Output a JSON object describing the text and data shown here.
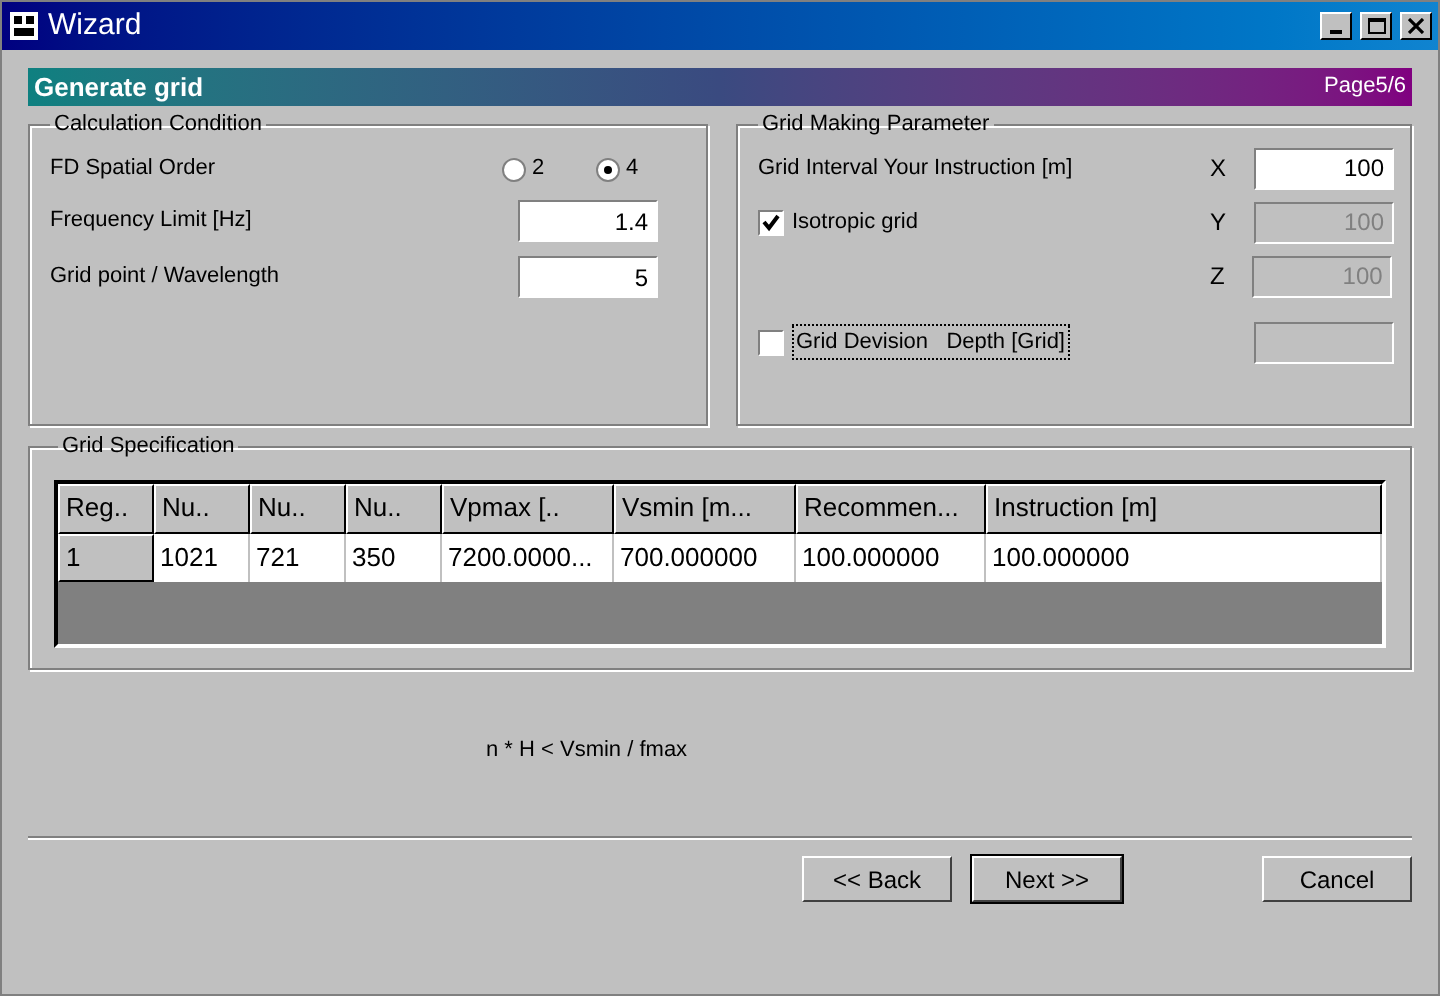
{
  "window": {
    "title": "Wizard"
  },
  "header": {
    "title": "Generate grid",
    "page": "Page5/6"
  },
  "calculation": {
    "title": "Calculation Condition",
    "order_label": "FD Spatial Order",
    "order_options": [
      {
        "label": "2",
        "selected": false
      },
      {
        "label": "4",
        "selected": true
      }
    ],
    "fields": [
      {
        "label": "Frequency Limit [Hz]",
        "value": "1.4"
      },
      {
        "label": "Grid point / Wavelength",
        "value": "5"
      }
    ]
  },
  "grid_making": {
    "title": "Grid Making Parameter",
    "interval_label": "Grid Interval Your Instruction [m]",
    "axes": [
      {
        "label": "X",
        "value": "100",
        "disabled": false
      },
      {
        "label": "Y",
        "value": "100",
        "disabled": true
      },
      {
        "label": "Z",
        "value": "100",
        "disabled": true
      }
    ],
    "isotropic": {
      "label": "Isotropic grid",
      "checked": true
    },
    "division": {
      "label": "Grid Devision   Depth [Grid]",
      "checked": false,
      "field_disabled": true
    }
  },
  "grid_specification": {
    "title": "Grid Specification",
    "columns": [
      "Reg..",
      "Nu..",
      "Nu..",
      "Nu..",
      "Vpmax [..",
      "Vsmin [m...",
      "Recommen...",
      "Instruction [m]"
    ],
    "rows": [
      [
        "1",
        "1021",
        "721",
        "350",
        "7200.0000...",
        "700.000000",
        "100.000000",
        "100.000000"
      ]
    ]
  },
  "formula": "n * H < Vsmin / fmax",
  "buttons": [
    {
      "label": "<< Back",
      "default": false
    },
    {
      "label": "Next >>",
      "default": true
    },
    {
      "label": "Cancel",
      "default": false
    }
  ]
}
